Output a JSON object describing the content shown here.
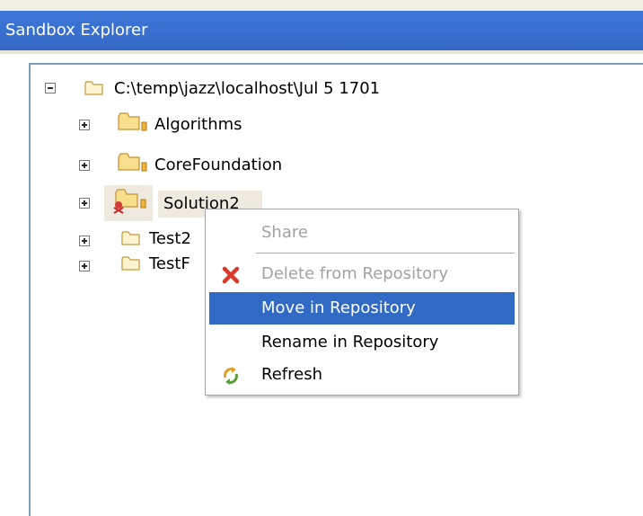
{
  "panel": {
    "title": "Sandbox Explorer"
  },
  "tree": {
    "root": {
      "label": "C:\\temp\\jazz\\localhost\\Jul 5 1701"
    },
    "children": [
      {
        "label": "Algorithms"
      },
      {
        "label": "CoreFoundation"
      },
      {
        "label": "Solution2"
      },
      {
        "label": "Test2"
      },
      {
        "label": "TestF"
      }
    ]
  },
  "context_menu": {
    "items": [
      {
        "label": "Share",
        "enabled": false
      },
      {
        "label": "Delete from Repository",
        "enabled": false,
        "icon": "delete-icon"
      },
      {
        "label": "Move in Repository",
        "enabled": true,
        "highlighted": true
      },
      {
        "label": "Rename in Repository",
        "enabled": true
      },
      {
        "label": "Refresh",
        "enabled": true,
        "icon": "refresh-icon"
      }
    ]
  },
  "colors": {
    "title_bar": "#3a6fcf",
    "menu_highlight": "#316ac5",
    "folder": "#f3d27a"
  }
}
